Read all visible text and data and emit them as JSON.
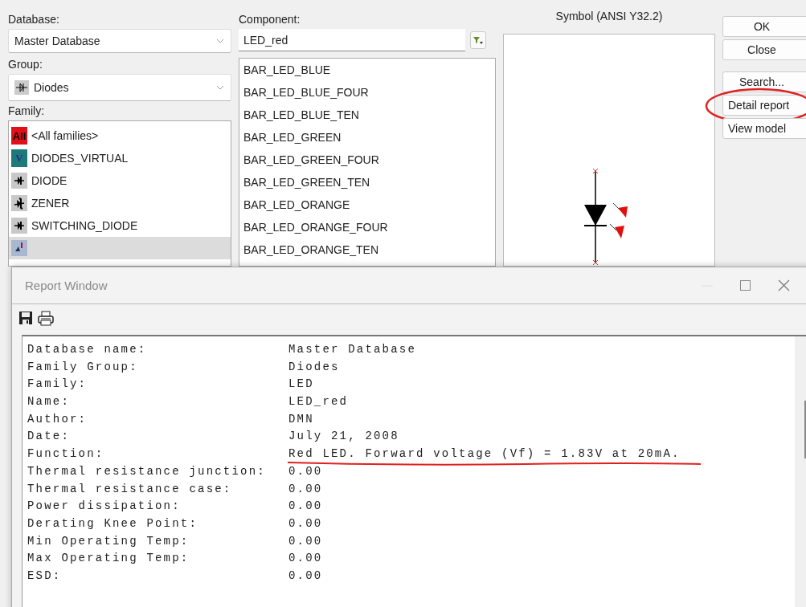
{
  "database": {
    "label": "Database:",
    "value": "Master Database"
  },
  "group": {
    "label": "Group:",
    "value": "Diodes"
  },
  "family": {
    "label": "Family:",
    "items": [
      {
        "kind": "all",
        "badge": "All",
        "label": "<All families>",
        "selected": false
      },
      {
        "kind": "virtual",
        "badge": "V",
        "label": "DIODES_VIRTUAL",
        "selected": false
      },
      {
        "kind": "diode",
        "label": "DIODE",
        "selected": false
      },
      {
        "kind": "zener",
        "label": "ZENER",
        "selected": false
      },
      {
        "kind": "switching",
        "label": "SWITCHING_DIODE",
        "selected": false
      },
      {
        "kind": "led",
        "selected": true
      }
    ]
  },
  "component": {
    "label": "Component:",
    "value": "LED_red",
    "items": [
      {
        "label": "BAR_LED_BLUE",
        "selected": false
      },
      {
        "label": "BAR_LED_BLUE_FOUR",
        "selected": false
      },
      {
        "label": "BAR_LED_BLUE_TEN",
        "selected": false
      },
      {
        "label": "BAR_LED_GREEN",
        "selected": false
      },
      {
        "label": "BAR_LED_GREEN_FOUR",
        "selected": false
      },
      {
        "label": "BAR_LED_GREEN_TEN",
        "selected": false
      },
      {
        "label": "BAR_LED_ORANGE",
        "selected": false
      },
      {
        "label": "BAR_LED_ORANGE_FOUR",
        "selected": false
      },
      {
        "label": "BAR_LED_ORANGE_TEN",
        "selected": false
      }
    ]
  },
  "symbol": {
    "title": "Symbol (ANSI Y32.2)"
  },
  "buttons": [
    {
      "label": "OK",
      "circled": false
    },
    {
      "label": "Close",
      "circled": false
    },
    {
      "label": "Search...",
      "circled": false
    },
    {
      "label": "Detail report",
      "circled": true
    },
    {
      "label": "View model",
      "circled": false
    }
  ],
  "report": {
    "title": "Report Window",
    "rows": [
      {
        "label": "Database name:",
        "value": "Master Database",
        "underlined": false
      },
      {
        "label": "Family Group:",
        "value": "Diodes",
        "underlined": false
      },
      {
        "label": "Family:",
        "value": "LED",
        "underlined": false
      },
      {
        "label": "Name:",
        "value": "LED_red",
        "underlined": false
      },
      {
        "label": "Author:",
        "value": "DMN",
        "underlined": false
      },
      {
        "label": "Date:",
        "value": "July 21, 2008",
        "underlined": false
      },
      {
        "label": "Function:",
        "value": "Red LED. Forward voltage (Vf) = 1.83V at 20mA.",
        "underlined": true
      },
      {
        "label": "Thermal resistance junction:",
        "value": "0.00",
        "underlined": false
      },
      {
        "label": "Thermal resistance case:",
        "value": "0.00",
        "underlined": false
      },
      {
        "label": "Power dissipation:",
        "value": "0.00",
        "underlined": false
      },
      {
        "label": "Derating Knee Point:",
        "value": "0.00",
        "underlined": false
      },
      {
        "label": "Min Operating Temp:",
        "value": "0.00",
        "underlined": false
      },
      {
        "label": "Max Operating Temp:",
        "value": "0.00",
        "underlined": false
      },
      {
        "label": "ESD:",
        "value": "0.00",
        "underlined": false
      }
    ]
  }
}
